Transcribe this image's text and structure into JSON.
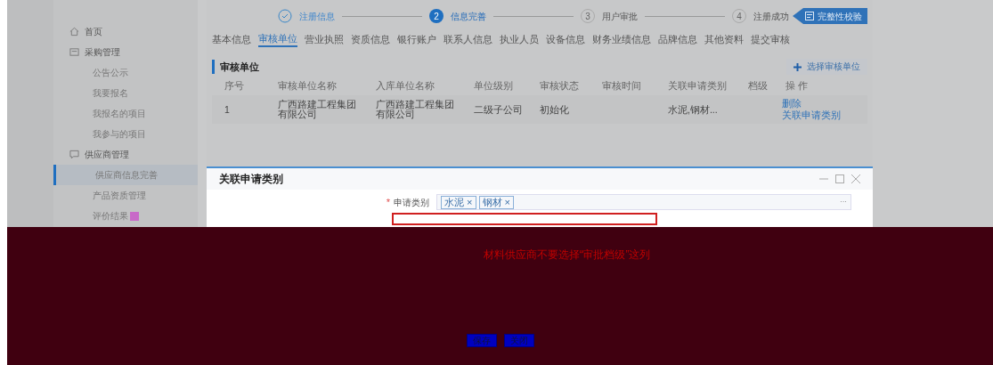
{
  "sidebar": {
    "items": [
      {
        "label": "首页",
        "kind": "home",
        "selected": false
      },
      {
        "label": "采购管理",
        "kind": "folder",
        "selected": false
      },
      {
        "label": "公告公示",
        "kind": "item",
        "selected": false
      },
      {
        "label": "我要报名",
        "kind": "item",
        "selected": false
      },
      {
        "label": "我报名的项目",
        "kind": "item",
        "selected": false
      },
      {
        "label": "我参与的项目",
        "kind": "item",
        "selected": false
      },
      {
        "label": "供应商管理",
        "kind": "chat",
        "selected": false
      },
      {
        "label": "供应商信息完善",
        "kind": "item",
        "selected": true
      },
      {
        "label": "产品资质管理",
        "kind": "item",
        "selected": false
      },
      {
        "label": "评价结果",
        "kind": "item",
        "selected": false,
        "badge": true
      }
    ]
  },
  "steps": [
    {
      "label": "注册信息",
      "done": true,
      "selected": false
    },
    {
      "number": "2",
      "label": "信息完善",
      "done": false,
      "selected": true
    },
    {
      "number": "3",
      "label": "用户审批",
      "done": false,
      "selected": false
    },
    {
      "number": "4",
      "label": "注册成功",
      "done": false,
      "selected": false
    }
  ],
  "check_button": "完整性校验",
  "tabs": [
    {
      "label": "基本信息",
      "selected": false
    },
    {
      "label": "审核单位",
      "selected": true
    },
    {
      "label": "营业执照",
      "selected": false
    },
    {
      "label": "资质信息",
      "selected": false
    },
    {
      "label": "银行账户",
      "selected": false
    },
    {
      "label": "联系人信息",
      "selected": false
    },
    {
      "label": "执业人员",
      "selected": false
    },
    {
      "label": "设备信息",
      "selected": false
    },
    {
      "label": "财务业绩信息",
      "selected": false
    },
    {
      "label": "品牌信息",
      "selected": false
    },
    {
      "label": "其他资料",
      "selected": false
    },
    {
      "label": "提交审核",
      "selected": false
    }
  ],
  "section": {
    "title": "审核单位",
    "add_button": "选择审核单位"
  },
  "table": {
    "columns": [
      "序号",
      "审核单位名称",
      "入库单位名称",
      "单位级别",
      "审核状态",
      "审核时间",
      "关联申请类别",
      "档级",
      "操 作"
    ],
    "rows": [
      {
        "cells": [
          "1",
          "广西路建工程集团有限公司",
          "广西路建工程集团有限公司",
          "二级子公司",
          "初始化",
          "",
          "水泥,钢材...",
          ""
        ],
        "actions": [
          "删除",
          "关联申请类别"
        ]
      }
    ]
  },
  "dialog": {
    "title": "关联申请类别",
    "required_mark": "*",
    "field_label": "申请类别",
    "tags": [
      {
        "label": "水泥",
        "close": "×"
      },
      {
        "label": "钢材",
        "close": "×"
      }
    ],
    "more": "···"
  },
  "notice": {
    "message": "材料供应商不要选择“审批档级”这列",
    "buttons": [
      "保存",
      "关闭"
    ]
  }
}
